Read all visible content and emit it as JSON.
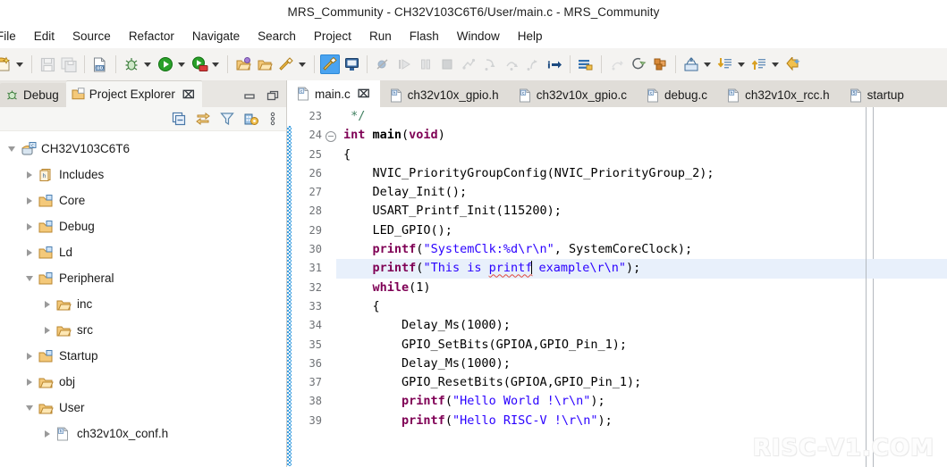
{
  "window": {
    "title": "MRS_Community - CH32V103C6T6/User/main.c - MRS_Community"
  },
  "menubar": {
    "items": [
      {
        "label": "File"
      },
      {
        "label": "Edit"
      },
      {
        "label": "Source"
      },
      {
        "label": "Refactor"
      },
      {
        "label": "Navigate"
      },
      {
        "label": "Search"
      },
      {
        "label": "Project"
      },
      {
        "label": "Run"
      },
      {
        "label": "Flash"
      },
      {
        "label": "Window"
      },
      {
        "label": "Help"
      }
    ]
  },
  "toolbar": {
    "items": [
      {
        "name": "new-wizard-icon",
        "arrow": true
      },
      {
        "name": "save-icon",
        "arrow": false
      },
      {
        "name": "save-all-icon",
        "arrow": false
      },
      {
        "name": "build-all-icon",
        "arrow": false
      },
      {
        "name": "debug-icon",
        "arrow": true
      },
      {
        "name": "run-icon",
        "arrow": true
      },
      {
        "name": "download-run-icon",
        "arrow": true
      },
      {
        "name": "open-project-icon",
        "arrow": false
      },
      {
        "name": "close-project-icon",
        "arrow": false
      },
      {
        "name": "build-configure-icon",
        "arrow": true
      },
      {
        "name": "build-hammer-icon",
        "arrow": false,
        "selected": true
      },
      {
        "name": "terminal-icon",
        "arrow": false
      },
      {
        "name": "skip-breakpoints-icon",
        "arrow": false
      },
      {
        "name": "resume-icon",
        "arrow": false
      },
      {
        "name": "suspend-icon",
        "arrow": false
      },
      {
        "name": "terminate-icon",
        "arrow": false
      },
      {
        "name": "disconnect-icon",
        "arrow": false
      },
      {
        "name": "step-into-icon",
        "arrow": false
      },
      {
        "name": "step-over-icon",
        "arrow": false
      },
      {
        "name": "step-return-icon",
        "arrow": false
      },
      {
        "name": "instruction-stepping-icon",
        "arrow": false
      },
      {
        "name": "toggle-breakpoint-icon",
        "arrow": false
      },
      {
        "name": "drop-to-frame-icon",
        "arrow": false
      },
      {
        "name": "refresh-icon",
        "arrow": false
      },
      {
        "name": "new-c-class-icon",
        "arrow": false
      },
      {
        "name": "open-type-icon",
        "arrow": true
      },
      {
        "name": "next-annotation-icon",
        "arrow": true
      },
      {
        "name": "previous-annotation-icon",
        "arrow": true
      },
      {
        "name": "back-icon",
        "arrow": false
      }
    ]
  },
  "left_view": {
    "tabs": [
      {
        "label": "Debug",
        "icon": "debug-perspective-icon",
        "active": false,
        "closable": false
      },
      {
        "label": "Project Explorer",
        "icon": "project-explorer-icon",
        "active": true,
        "closable": true
      }
    ],
    "close_glyph": "⌧",
    "window_controls": [
      {
        "name": "minimize-view-button"
      },
      {
        "name": "maximize-view-button"
      }
    ],
    "tree_toolbar": [
      {
        "name": "collapse-all-icon"
      },
      {
        "name": "link-with-editor-icon"
      },
      {
        "name": "filters-icon"
      },
      {
        "name": "view-settings-icon"
      },
      {
        "name": "view-menu-icon"
      }
    ],
    "tree": [
      {
        "label": "CH32V103C6T6",
        "depth": 0,
        "twist": "open",
        "icon": "c-project-icon"
      },
      {
        "label": "Includes",
        "depth": 1,
        "twist": "closed",
        "icon": "includes-icon"
      },
      {
        "label": "Core",
        "depth": 1,
        "twist": "closed",
        "icon": "source-folder-icon"
      },
      {
        "label": "Debug",
        "depth": 1,
        "twist": "closed",
        "icon": "source-folder-icon"
      },
      {
        "label": "Ld",
        "depth": 1,
        "twist": "closed",
        "icon": "source-folder-icon"
      },
      {
        "label": "Peripheral",
        "depth": 1,
        "twist": "open",
        "icon": "source-folder-icon"
      },
      {
        "label": "inc",
        "depth": 2,
        "twist": "closed",
        "icon": "folder-icon"
      },
      {
        "label": "src",
        "depth": 2,
        "twist": "closed",
        "icon": "folder-icon"
      },
      {
        "label": "Startup",
        "depth": 1,
        "twist": "closed",
        "icon": "source-folder-icon"
      },
      {
        "label": "obj",
        "depth": 1,
        "twist": "closed",
        "icon": "folder-icon"
      },
      {
        "label": "User",
        "depth": 1,
        "twist": "open",
        "icon": "folder-icon"
      },
      {
        "label": "ch32v10x_conf.h",
        "depth": 2,
        "twist": "closed",
        "icon": "h-file-icon"
      }
    ]
  },
  "editor": {
    "tabs": [
      {
        "label": "main.c",
        "icon": "c-file-icon",
        "active": true,
        "closable": true
      },
      {
        "label": "ch32v10x_gpio.h",
        "icon": "h-file-icon",
        "active": false,
        "closable": false
      },
      {
        "label": "ch32v10x_gpio.c",
        "icon": "c-file-icon",
        "active": false,
        "closable": false
      },
      {
        "label": "debug.c",
        "icon": "c-file-icon",
        "active": false,
        "closable": false
      },
      {
        "label": "ch32v10x_rcc.h",
        "icon": "h-file-icon",
        "active": false,
        "closable": false
      },
      {
        "label": "startup",
        "icon": "s-file-icon",
        "active": false,
        "closable": false
      }
    ],
    "close_glyph": "⌧",
    "first_line_number": 23,
    "highlighted_line": 31,
    "change_bar_from_line": 24,
    "fold_marker_line": 24,
    "lines": [
      {
        "n": 23,
        "tokens": [
          {
            "t": " */",
            "c": "cmt"
          }
        ]
      },
      {
        "n": 24,
        "fold": true,
        "tokens": [
          {
            "t": "int ",
            "c": "kw"
          },
          {
            "t": "main",
            "c": "plain-b"
          },
          {
            "t": "(",
            "c": "plain"
          },
          {
            "t": "void",
            "c": "kw"
          },
          {
            "t": ")",
            "c": "plain"
          }
        ]
      },
      {
        "n": 25,
        "tokens": [
          {
            "t": "{",
            "c": "plain"
          }
        ]
      },
      {
        "n": 26,
        "tokens": [
          {
            "t": "    NVIC_PriorityGroupConfig(NVIC_PriorityGroup_2);",
            "c": "plain"
          }
        ]
      },
      {
        "n": 27,
        "tokens": [
          {
            "t": "    Delay_Init();",
            "c": "plain"
          }
        ]
      },
      {
        "n": 28,
        "tokens": [
          {
            "t": "    USART_Printf_Init(115200);",
            "c": "plain"
          }
        ]
      },
      {
        "n": 29,
        "tokens": [
          {
            "t": "    LED_GPIO();",
            "c": "plain"
          }
        ]
      },
      {
        "n": 30,
        "tokens": [
          {
            "t": "    ",
            "c": "plain"
          },
          {
            "t": "printf",
            "c": "kw"
          },
          {
            "t": "(",
            "c": "plain"
          },
          {
            "t": "\"SystemClk:%d\\r\\n\"",
            "c": "str"
          },
          {
            "t": ", SystemCoreClock);",
            "c": "plain"
          }
        ]
      },
      {
        "n": 31,
        "hl": true,
        "tokens": [
          {
            "t": "    ",
            "c": "plain"
          },
          {
            "t": "printf",
            "c": "kw"
          },
          {
            "t": "(",
            "c": "plain"
          },
          {
            "t": "\"This is ",
            "c": "str"
          },
          {
            "t": "printf",
            "c": "str-sp"
          },
          {
            "t": "",
            "c": "caret"
          },
          {
            "t": " example\\r\\n\"",
            "c": "str"
          },
          {
            "t": ");",
            "c": "plain"
          }
        ]
      },
      {
        "n": 32,
        "tokens": [
          {
            "t": "    ",
            "c": "plain"
          },
          {
            "t": "while",
            "c": "kw"
          },
          {
            "t": "(1)",
            "c": "plain"
          }
        ]
      },
      {
        "n": 33,
        "tokens": [
          {
            "t": "    {",
            "c": "plain"
          }
        ]
      },
      {
        "n": 34,
        "tokens": [
          {
            "t": "        Delay_Ms(1000);",
            "c": "plain"
          }
        ]
      },
      {
        "n": 35,
        "tokens": [
          {
            "t": "        GPIO_SetBits(GPIOA,GPIO_Pin_1);",
            "c": "plain"
          }
        ]
      },
      {
        "n": 36,
        "tokens": [
          {
            "t": "        Delay_Ms(1000);",
            "c": "plain"
          }
        ]
      },
      {
        "n": 37,
        "tokens": [
          {
            "t": "        GPIO_ResetBits(GPIOA,GPIO_Pin_1);",
            "c": "plain"
          }
        ]
      },
      {
        "n": 38,
        "tokens": [
          {
            "t": "        ",
            "c": "plain"
          },
          {
            "t": "printf",
            "c": "kw"
          },
          {
            "t": "(",
            "c": "plain"
          },
          {
            "t": "\"Hello World !\\r\\n\"",
            "c": "str"
          },
          {
            "t": ");",
            "c": "plain"
          }
        ]
      },
      {
        "n": 39,
        "tokens": [
          {
            "t": "        ",
            "c": "plain"
          },
          {
            "t": "printf",
            "c": "kw"
          },
          {
            "t": "(",
            "c": "plain"
          },
          {
            "t": "\"Hello RISC-V !\\r\\n\"",
            "c": "str"
          },
          {
            "t": ");",
            "c": "plain"
          }
        ]
      }
    ]
  },
  "watermark": {
    "text": "RISC-V1.COM"
  },
  "colors": {
    "accent": "#4aa3f0",
    "keyword": "#7f0055",
    "string": "#2a00ff",
    "comment": "#3f7f5f",
    "highlight_line": "#e8f0fb",
    "change_bar": "#3fa0e0"
  }
}
